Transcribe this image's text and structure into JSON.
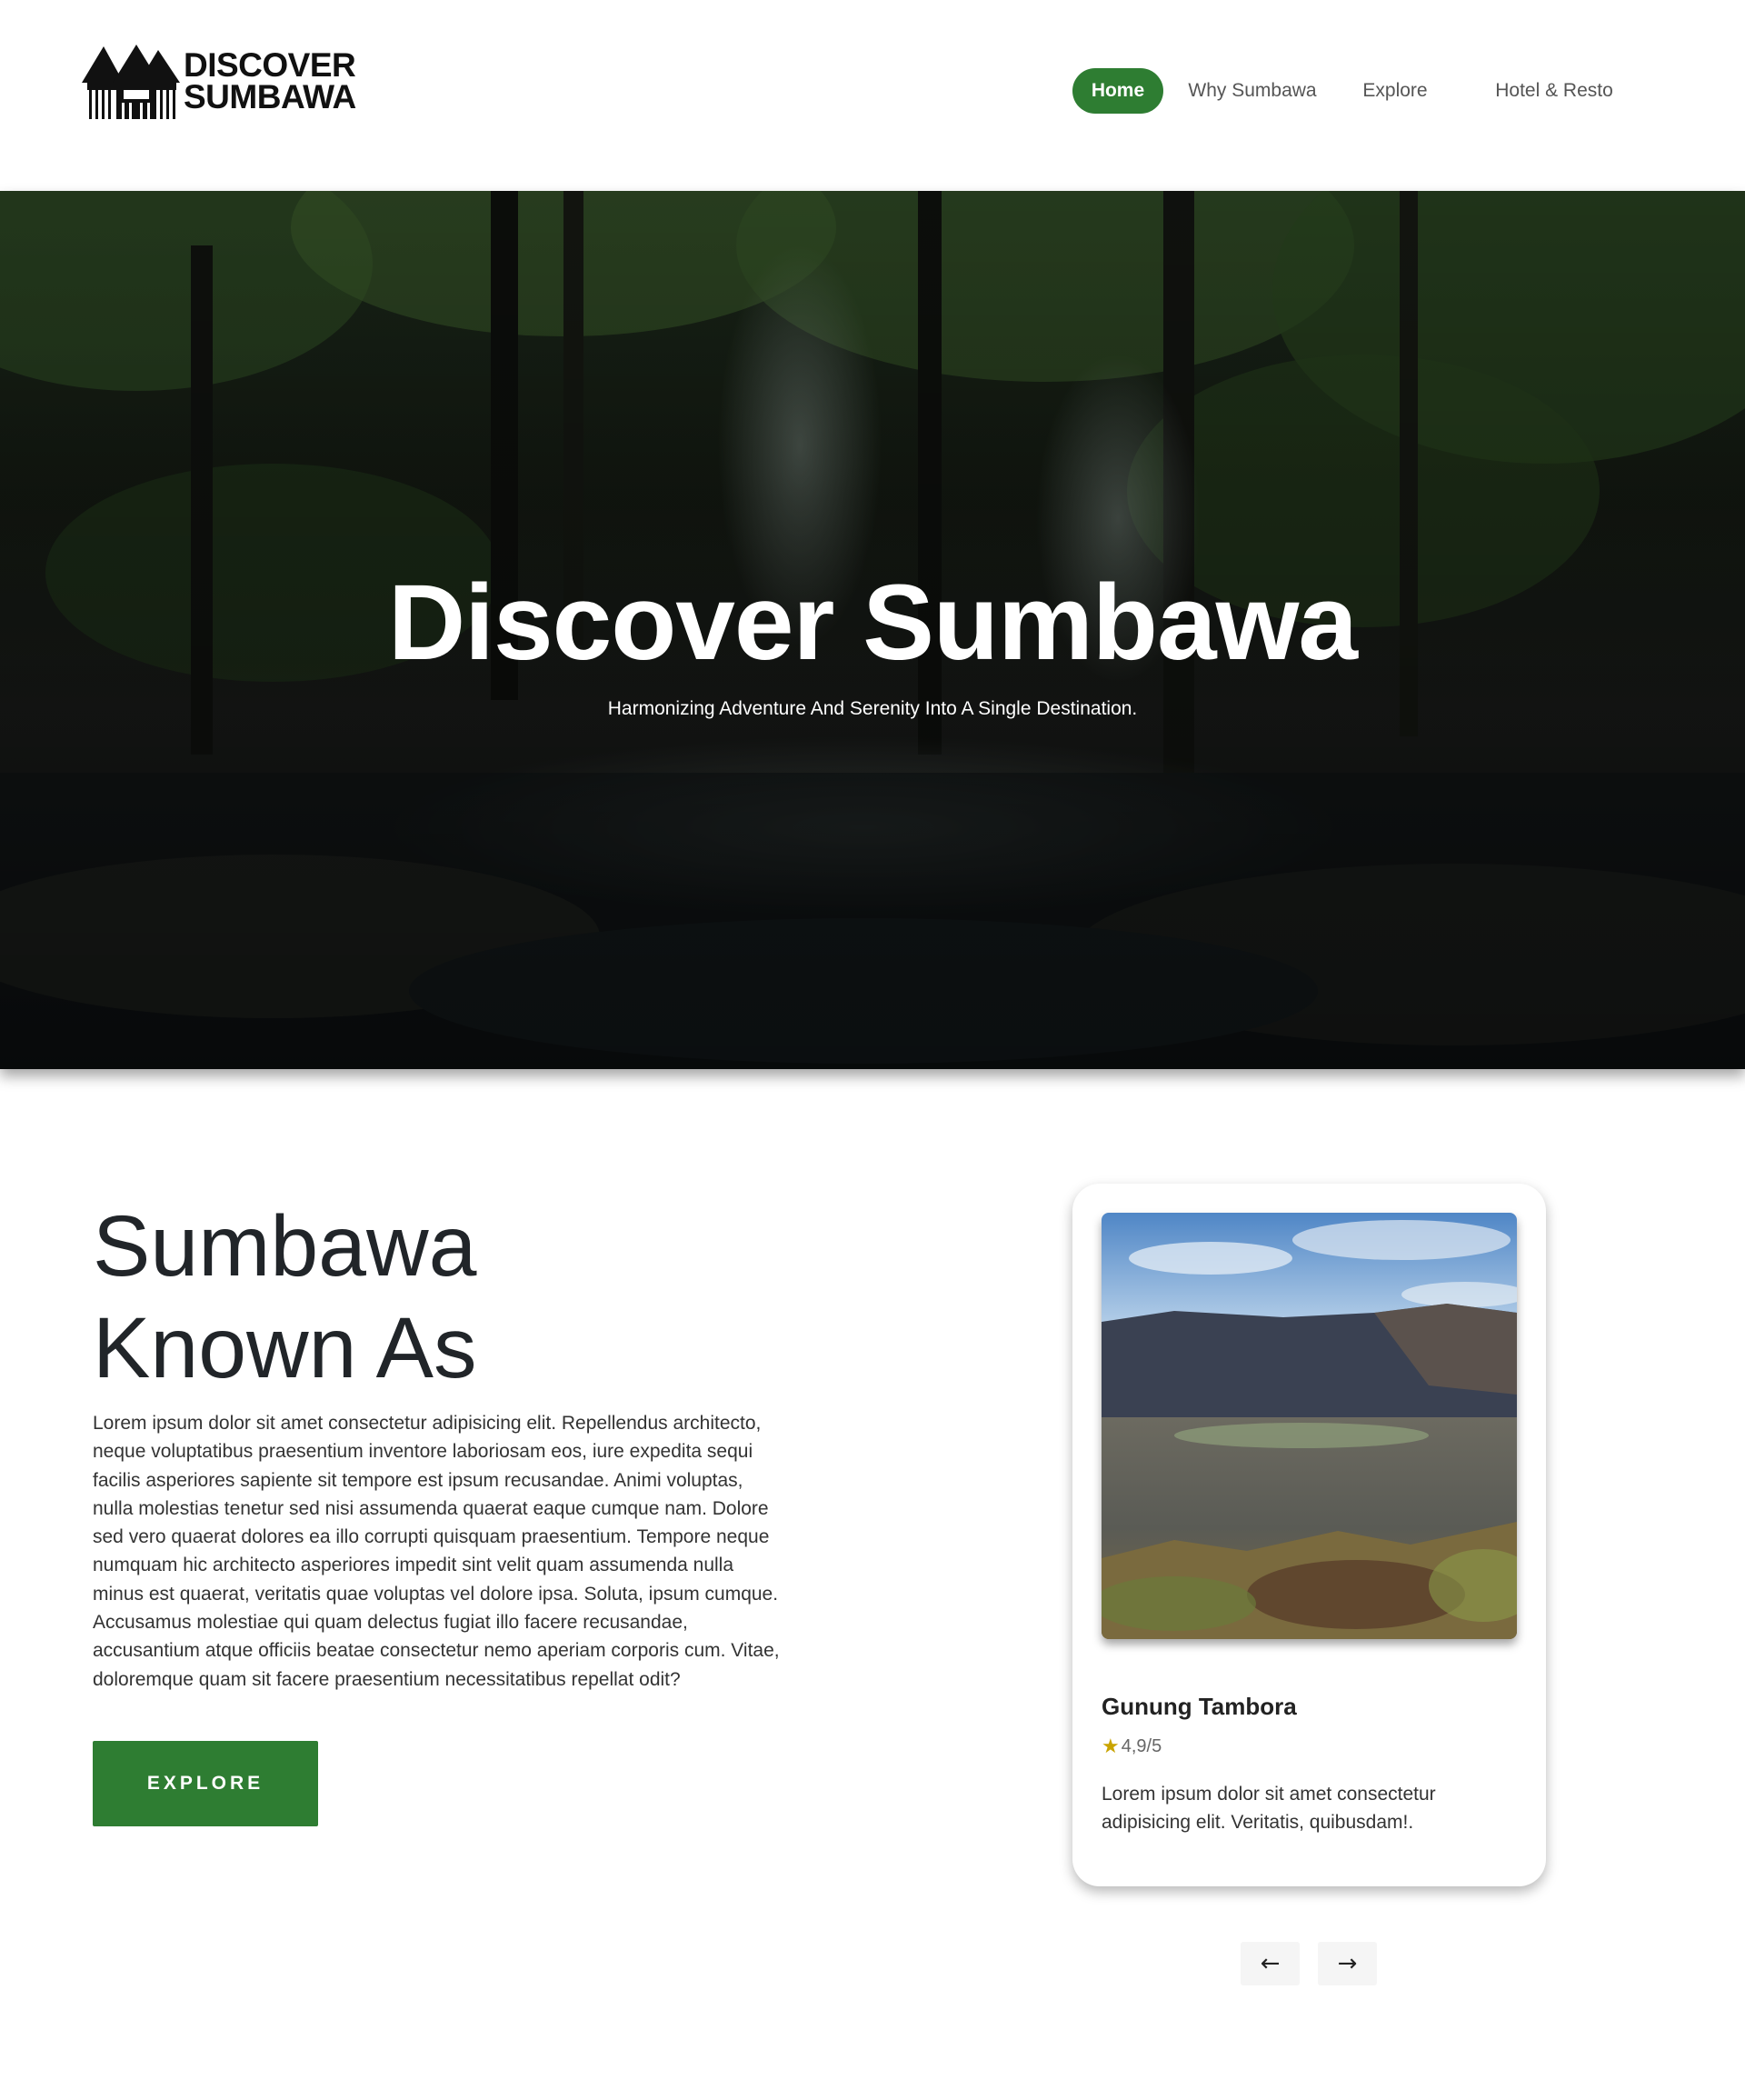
{
  "brand": {
    "line1": "DISCOVER",
    "line2": "SUMBAWA"
  },
  "nav": {
    "items": [
      {
        "label": "Home",
        "active": true
      },
      {
        "label": "Why Sumbawa",
        "active": false
      },
      {
        "label": "Explore",
        "active": false
      },
      {
        "label": "Hotel & Resto",
        "active": false
      }
    ]
  },
  "hero": {
    "title": "Discover Sumbawa",
    "subtitle": "Harmonizing Adventure And Serenity Into A Single Destination."
  },
  "about": {
    "title_line1": "Sumbawa",
    "title_line2": "Known As",
    "text": "Lorem ipsum dolor sit amet consectetur adipisicing elit. Repellendus architecto, neque voluptatibus praesentium inventore laboriosam eos, iure expedita sequi facilis asperiores sapiente sit tempore est ipsum recusandae. Animi voluptas, nulla molestias tenetur sed nisi assumenda quaerat eaque cumque nam. Dolore sed vero quaerat dolores ea illo corrupti quisquam praesentium. Tempore neque numquam hic architecto asperiores impedit sint velit quam assumenda nulla minus est quaerat, veritatis quae voluptas vel dolore ipsa. Soluta, ipsum cumque. Accusamus molestiae qui quam delectus fugiat illo facere recusandae, accusantium atque officiis beatae consectetur nemo aperiam corporis cum. Vitae, doloremque quam sit facere praesentium necessitatibus repellat odit?",
    "button_label": "EXPLORE"
  },
  "card": {
    "title": "Gunung Tambora",
    "rating": "4,9/5",
    "description": "Lorem ipsum dolor sit amet consectetur adipisicing elit. Veritatis, quibusdam!.",
    "accent_color": "#2e7d32",
    "star_color": "#c9a400"
  },
  "carousel": {
    "prev_icon": "arrow-left-icon",
    "next_icon": "arrow-right-icon",
    "prev_glyph": "←",
    "next_glyph": "→"
  }
}
